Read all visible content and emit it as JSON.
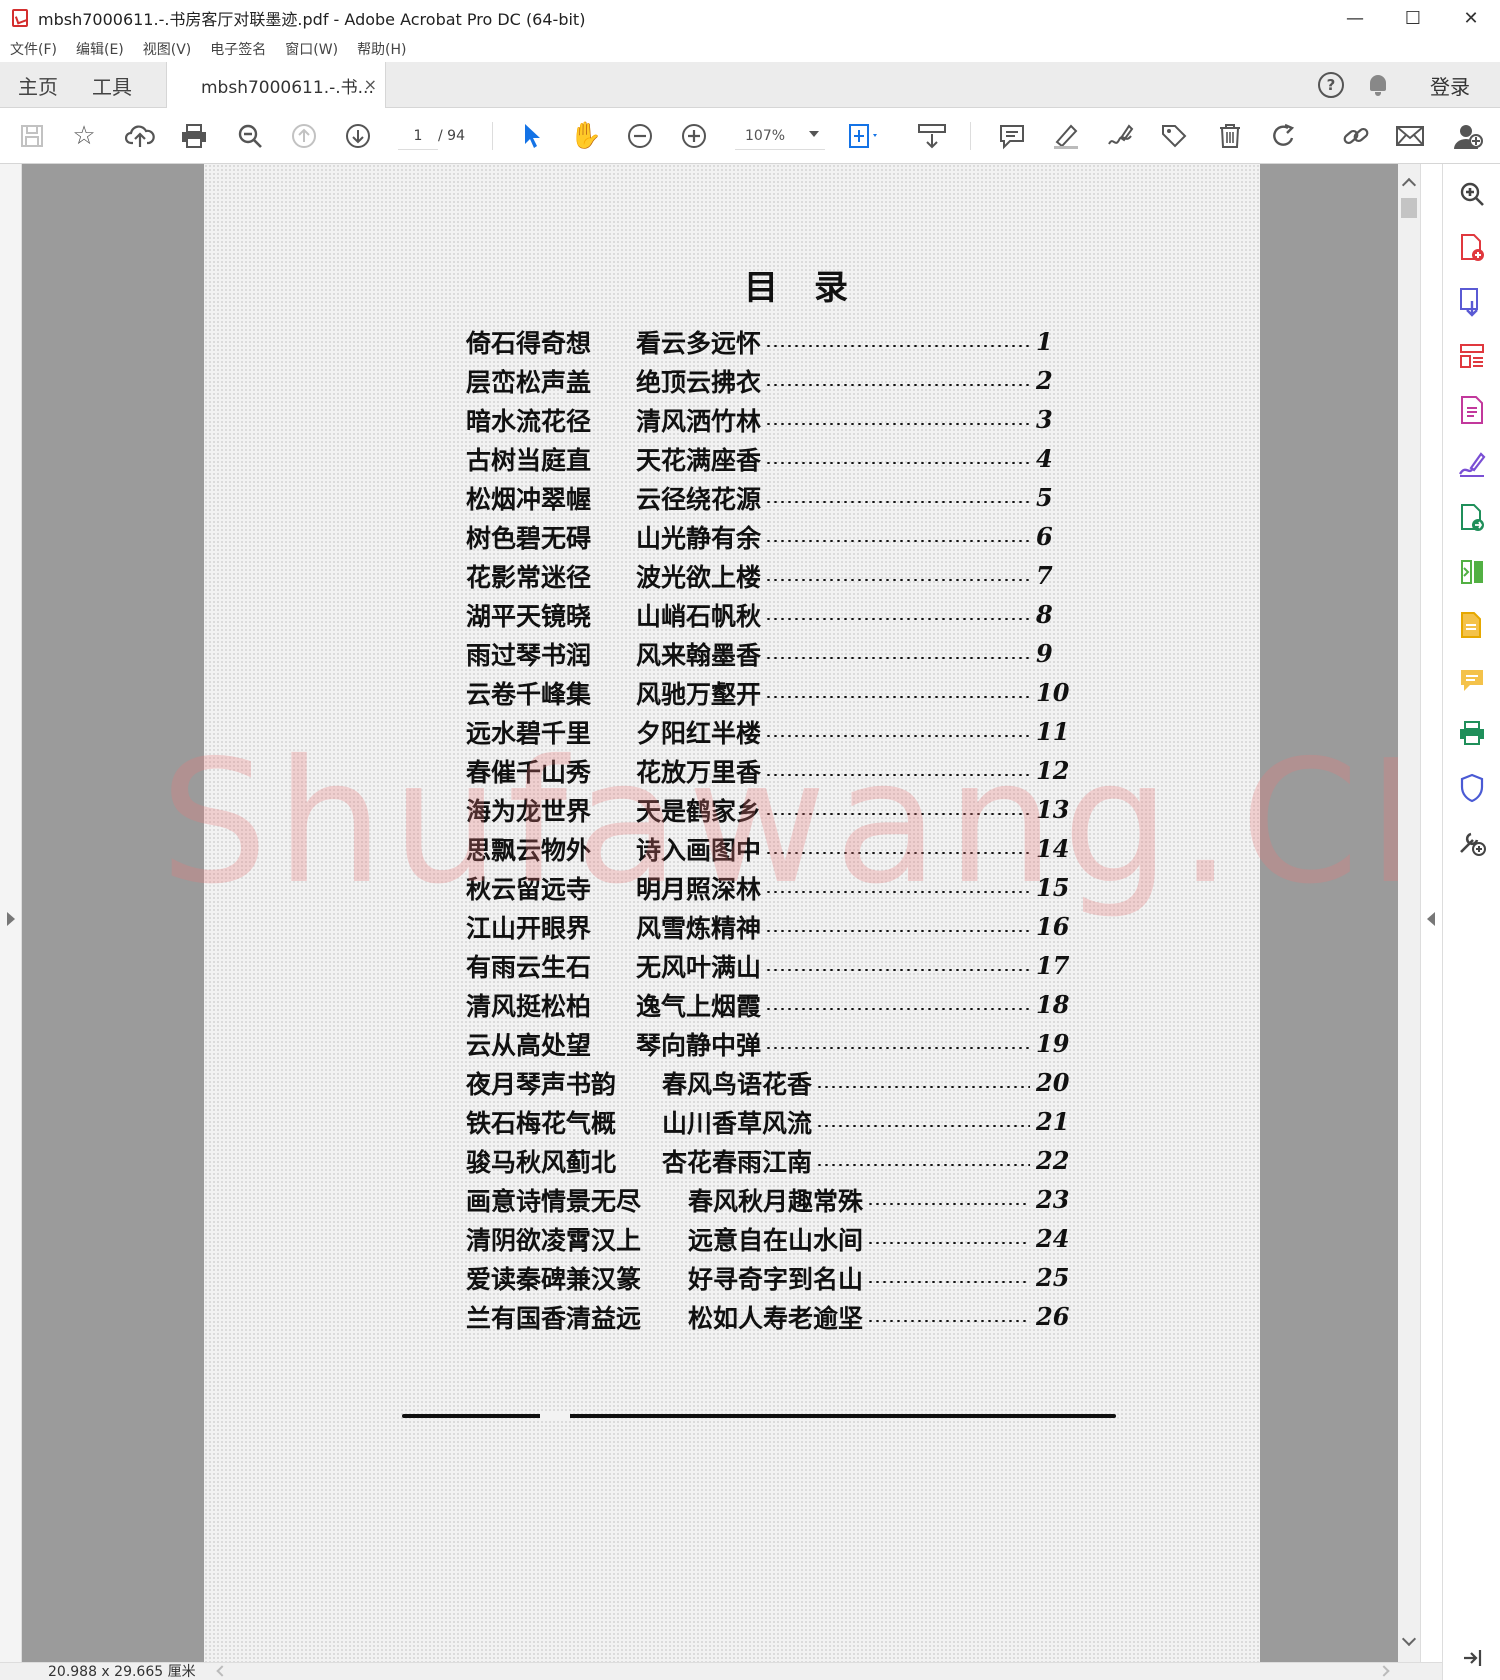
{
  "window": {
    "title": "mbsh7000611.-.书房客厅对联墨迹.pdf - Adobe Acrobat Pro DC (64-bit)",
    "controls": {
      "minimize": "—",
      "maximize": "☐",
      "close": "✕"
    }
  },
  "menu": [
    "文件(F)",
    "编辑(E)",
    "视图(V)",
    "电子签名",
    "窗口(W)",
    "帮助(H)"
  ],
  "tabs": {
    "home": "主页",
    "tools": "工具",
    "document": "mbsh7000611.-.书...",
    "close": "×",
    "help": "?",
    "login": "登录"
  },
  "toolbar": {
    "page_current": "1",
    "page_total": "/ 94",
    "zoom": "107%"
  },
  "page": {
    "title": "目录",
    "toc": [
      {
        "a": "倚石得奇想",
        "b": "看云多远怀",
        "n": "1"
      },
      {
        "a": "层峦松声盖",
        "b": "绝顶云拂衣",
        "n": "2"
      },
      {
        "a": "暗水流花径",
        "b": "清风洒竹林",
        "n": "3"
      },
      {
        "a": "古树当庭直",
        "b": "天花满座香",
        "n": "4"
      },
      {
        "a": "松烟冲翠幄",
        "b": "云径绕花源",
        "n": "5"
      },
      {
        "a": "树色碧无碍",
        "b": "山光静有余",
        "n": "6"
      },
      {
        "a": "花影常迷径",
        "b": "波光欲上楼",
        "n": "7"
      },
      {
        "a": "湖平天镜晓",
        "b": "山峭石帆秋",
        "n": "8"
      },
      {
        "a": "雨过琴书润",
        "b": "风来翰墨香",
        "n": "9"
      },
      {
        "a": "云卷千峰集",
        "b": "风驰万壑开",
        "n": "10"
      },
      {
        "a": "远水碧千里",
        "b": "夕阳红半楼",
        "n": "11"
      },
      {
        "a": "春催千山秀",
        "b": "花放万里香",
        "n": "12"
      },
      {
        "a": "海为龙世界",
        "b": "天是鹤家乡",
        "n": "13"
      },
      {
        "a": "思飘云物外",
        "b": "诗入画图中",
        "n": "14"
      },
      {
        "a": "秋云留远寺",
        "b": "明月照深林",
        "n": "15"
      },
      {
        "a": "江山开眼界",
        "b": "风雪炼精神",
        "n": "16"
      },
      {
        "a": "有雨云生石",
        "b": "无风叶满山",
        "n": "17"
      },
      {
        "a": "清风挺松柏",
        "b": "逸气上烟霞",
        "n": "18"
      },
      {
        "a": "云从高处望",
        "b": "琴向静中弹",
        "n": "19"
      },
      {
        "a": "夜月琴声书韵",
        "b": "春风鸟语花香",
        "n": "20"
      },
      {
        "a": "铁石梅花气概",
        "b": "山川香草风流",
        "n": "21"
      },
      {
        "a": "骏马秋风蓟北",
        "b": "杏花春雨江南",
        "n": "22"
      },
      {
        "a": "画意诗情景无尽",
        "b": "春风秋月趣常殊",
        "n": "23"
      },
      {
        "a": "清阴欲凌霄汉上",
        "b": "远意自在山水间",
        "n": "24"
      },
      {
        "a": "爱读秦碑兼汉篆",
        "b": "好寻奇字到名山",
        "n": "25"
      },
      {
        "a": "兰有国香清益远",
        "b": "松如人寿老逾坚",
        "n": "26"
      }
    ],
    "watermark": "Shufawang.CN"
  },
  "status": {
    "size": "20.988 x 29.665 厘米"
  },
  "colors": {
    "accent": "#1473e6",
    "acrobat_red": "#d32f2f"
  },
  "icons": {
    "toolbar": [
      "save-icon",
      "bookmark-star-icon",
      "cloud-upload-icon",
      "print-icon",
      "zoom-out-magnifier-icon",
      "page-up-icon",
      "page-down-icon",
      "select-arrow-icon",
      "hand-icon",
      "zoom-minus-icon",
      "zoom-plus-icon",
      "fit-page-icon",
      "keyboard-scroll-icon",
      "comment-icon",
      "highlight-icon",
      "sign-icon",
      "stamp-icon",
      "delete-icon",
      "rotate-icon",
      "link-icon",
      "email-icon",
      "add-user-icon"
    ],
    "tools_pane": [
      "search-zoom-icon",
      "create-pdf-icon",
      "export-pdf-icon",
      "organize-pages-icon",
      "edit-pdf-icon",
      "fill-sign-icon",
      "send-for-signature-icon",
      "compare-icon",
      "redact-icon",
      "comment-tool-icon",
      "print-production-icon",
      "protect-icon",
      "more-tools-icon"
    ]
  }
}
